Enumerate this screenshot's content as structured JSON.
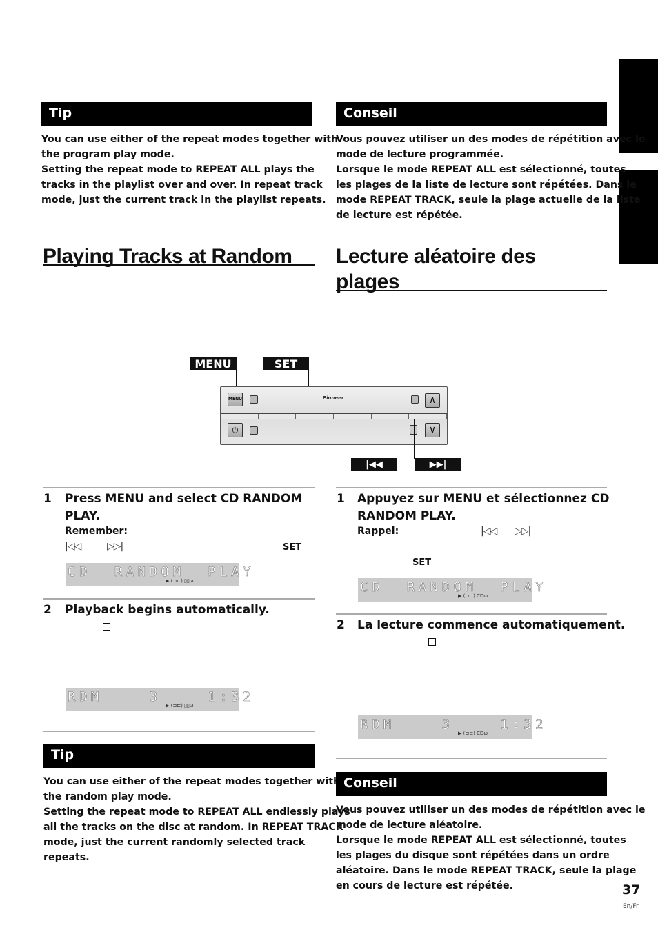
{
  "side_tabs": [
    "english-tab",
    "francais-tab"
  ],
  "left": {
    "tip1": {
      "heading": "Tip",
      "lines": [
        "You can use either of the repeat modes together with",
        "the program play mode.",
        "Setting the repeat mode to REPEAT ALL plays the",
        "tracks in the playlist over and over. In repeat track",
        "mode, just the current track in the playlist repeats."
      ]
    },
    "title": "Playing Tracks at Random",
    "step1": {
      "number": "1",
      "title_lines": [
        "Press MENU and select CD RANDOM",
        "PLAY."
      ],
      "remember_label": "Remember:",
      "prev_glyph": "|◁◁",
      "next_glyph": "▷▷|",
      "set_label": "SET",
      "lcd_text": "CD  RANDOM  PLAY",
      "lcd_indicator": "▶ (⊐⊏) ▯▯ω"
    },
    "step2": {
      "number": "2",
      "title": "Playback begins automatically.",
      "lcd_text": "RDM    3    1:32",
      "lcd_indicator": "▶ (⊐⊏) ▯▯ω"
    },
    "tip2": {
      "heading": "Tip",
      "lines": [
        "You can use either of the repeat modes together with",
        "the random play mode.",
        "Setting the repeat mode to REPEAT ALL endlessly plays",
        "all the tracks on the disc at random. In REPEAT TRACK",
        "mode, just the current randomly selected track",
        "repeats."
      ]
    }
  },
  "right": {
    "tip1": {
      "heading": "Conseil",
      "lines": [
        "Vous pouvez utiliser un des modes de répétition avec le",
        "mode de lecture programmée.",
        "Lorsque le mode REPEAT ALL est sélectionné, toutes",
        "les plages de la liste de lecture sont répétées. Dans le",
        "mode REPEAT TRACK, seule la plage actuelle de la liste",
        "de lecture est répétée."
      ]
    },
    "title_lines": [
      "Lecture aléatoire des",
      "plages"
    ],
    "step1": {
      "number": "1",
      "title_lines": [
        "Appuyez sur MENU et sélectionnez CD",
        "RANDOM PLAY."
      ],
      "remember_label": "Rappel:",
      "prev_glyph": "|◁◁",
      "next_glyph": "▷▷|",
      "set_label": "SET",
      "lcd_text": "CD  RANDOM  PLAY",
      "lcd_indicator": "▶ (⊐⊏) CDω"
    },
    "step2": {
      "number": "2",
      "title": "La lecture commence automatiquement.",
      "lcd_text": "RDM    3    1:32",
      "lcd_indicator": "▶ (⊐⊏) CDω"
    },
    "tip2": {
      "heading": "Conseil",
      "lines": [
        "Vous pouvez utiliser un des modes de répétition avec le",
        "mode de lecture aléatoire.",
        "Lorsque le mode REPEAT ALL est sélectionné, toutes",
        "les plages du disque sont répétées dans un ordre",
        "aléatoire. Dans le mode REPEAT TRACK, seule la plage",
        "en cours de lecture est répétée."
      ]
    }
  },
  "diagram": {
    "menu_label": "MENU",
    "set_label": "SET",
    "prev_label": "|◀◀",
    "next_label": "▶▶|",
    "panel": {
      "menu_button": "MENU",
      "brand": "Pioneer",
      "up_arrow": "∧",
      "down_arrow": "∨",
      "power_glyph": "⏻"
    }
  },
  "footer": {
    "page_number": "37",
    "language": "En/Fr"
  }
}
